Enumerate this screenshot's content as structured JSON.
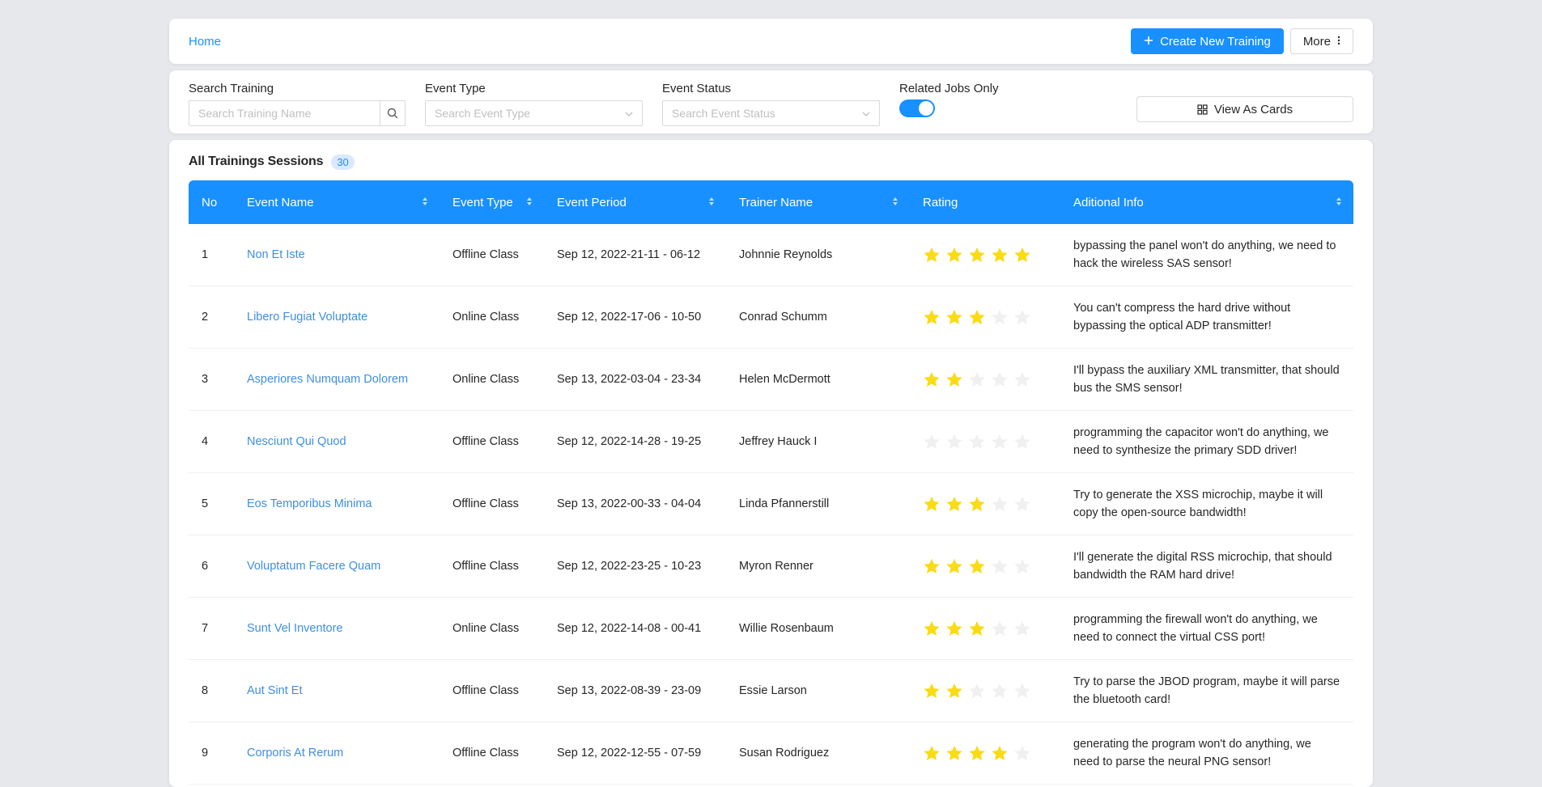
{
  "header": {
    "home": "Home",
    "create_label": "Create New Training",
    "more_label": "More"
  },
  "filters": {
    "search_label": "Search Training",
    "search_placeholder": "Search Training Name",
    "event_type_label": "Event Type",
    "event_type_placeholder": "Search Event Type",
    "event_status_label": "Event Status",
    "event_status_placeholder": "Search Event Status",
    "related_label": "Related Jobs Only",
    "related_on": true,
    "view_cards_label": "View As Cards"
  },
  "table": {
    "title": "All Trainings Sessions",
    "count": "30",
    "columns": [
      "No",
      "Event Name",
      "Event Type",
      "Event Period",
      "Trainer Name",
      "Rating",
      "Aditional Info"
    ],
    "rows": [
      {
        "no": "1",
        "name": "Non Et Iste",
        "type": "Offline Class",
        "period": "Sep 12, 2022-21-11 - 06-12",
        "trainer": "Johnnie Reynolds",
        "rating": 5,
        "info": "bypassing the panel won't do anything, we need to hack the wireless SAS sensor!"
      },
      {
        "no": "2",
        "name": "Libero Fugiat Voluptate",
        "type": "Online Class",
        "period": "Sep 12, 2022-17-06 - 10-50",
        "trainer": "Conrad Schumm",
        "rating": 3,
        "info": "You can't compress the hard drive without bypassing the optical ADP transmitter!"
      },
      {
        "no": "3",
        "name": "Asperiores Numquam Dolorem",
        "type": "Online Class",
        "period": "Sep 13, 2022-03-04 - 23-34",
        "trainer": "Helen McDermott",
        "rating": 2,
        "info": "I'll bypass the auxiliary XML transmitter, that should bus the SMS sensor!"
      },
      {
        "no": "4",
        "name": "Nesciunt Qui Quod",
        "type": "Offline Class",
        "period": "Sep 12, 2022-14-28 - 19-25",
        "trainer": "Jeffrey Hauck I",
        "rating": 0,
        "info": "programming the capacitor won't do anything, we need to synthesize the primary SDD driver!"
      },
      {
        "no": "5",
        "name": "Eos Temporibus Minima",
        "type": "Offline Class",
        "period": "Sep 13, 2022-00-33 - 04-04",
        "trainer": "Linda Pfannerstill",
        "rating": 3,
        "info": "Try to generate the XSS microchip, maybe it will copy the open-source bandwidth!"
      },
      {
        "no": "6",
        "name": "Voluptatum Facere Quam",
        "type": "Offline Class",
        "period": "Sep 12, 2022-23-25 - 10-23",
        "trainer": "Myron Renner",
        "rating": 3,
        "info": "I'll generate the digital RSS microchip, that should bandwidth the RAM hard drive!"
      },
      {
        "no": "7",
        "name": "Sunt Vel Inventore",
        "type": "Online Class",
        "period": "Sep 12, 2022-14-08 - 00-41",
        "trainer": "Willie Rosenbaum",
        "rating": 3,
        "info": "programming the firewall won't do anything, we need to connect the virtual CSS port!"
      },
      {
        "no": "8",
        "name": "Aut Sint Et",
        "type": "Offline Class",
        "period": "Sep 13, 2022-08-39 - 23-09",
        "trainer": "Essie Larson",
        "rating": 2,
        "info": "Try to parse the JBOD program, maybe it will parse the bluetooth card!"
      },
      {
        "no": "9",
        "name": "Corporis At Rerum",
        "type": "Offline Class",
        "period": "Sep 12, 2022-12-55 - 07-59",
        "trainer": "Susan Rodriguez",
        "rating": 4,
        "info": "generating the program won't do anything, we need to parse the neural PNG sensor!"
      }
    ]
  },
  "colors": {
    "primary": "#1890ff",
    "star_on": "#fadb14",
    "star_off": "#f0f0f0"
  }
}
